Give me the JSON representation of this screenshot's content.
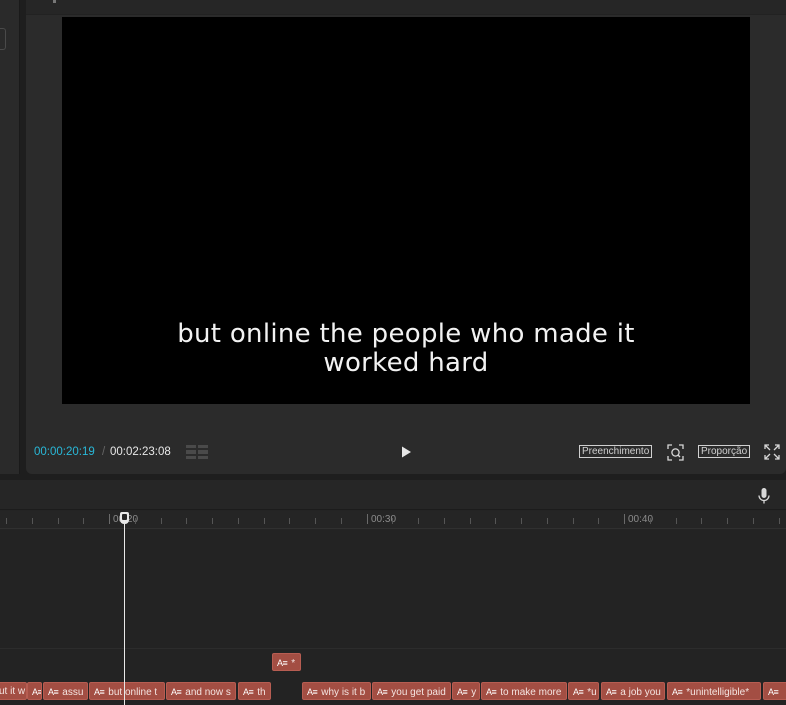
{
  "player": {
    "caption_line1": "but online the people who made it",
    "caption_line2": "worked hard",
    "current_time": "00:00:20:19",
    "separator": "/",
    "total_time": "00:02:23:08",
    "fill_label": "Preenchimento",
    "ratio_label": "Proporção"
  },
  "timeline": {
    "ruler_labels": [
      "00:20",
      "00:30",
      "00:40"
    ],
    "clip_icon_text": "A≡",
    "upper_clip": "*",
    "clips": [
      "ut it w",
      "",
      "assu",
      "but online t",
      "and now s",
      "th",
      "why is it b",
      "you get paid",
      "y",
      "to make more",
      "*u",
      "a job you",
      "*unintelligible*",
      ""
    ]
  },
  "colors": {
    "accent_timecode": "#29b8d8",
    "clip_fill": "#a34e43",
    "background": "#1e1e1e"
  }
}
